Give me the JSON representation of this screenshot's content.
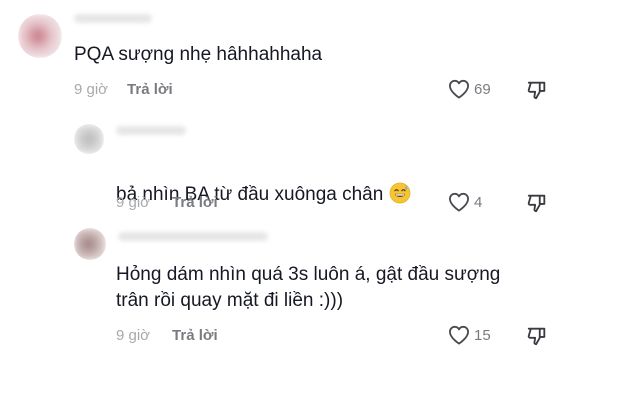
{
  "comments": [
    {
      "text": "PQA sượng nhẹ hâhhahhaha",
      "time": "9 giờ",
      "reply_label": "Trả lời",
      "likes": "69"
    },
    {
      "text": "bả nhìn BA từ đầu xuônga chân",
      "emoji": "grinning-sweat-emoji",
      "time": "9 giờ",
      "reply_label": "Trả lời",
      "likes": "4"
    },
    {
      "text": "Hỏng dám nhìn quá 3s luôn á, gật đầu sượng\ntrân rồi quay mặt đi liền :)))",
      "time": "9 giờ",
      "reply_label": "Trả lời",
      "likes": "15"
    }
  ],
  "icons": {
    "like": "heart-outline-icon",
    "dislike": "thumbs-down-icon"
  },
  "colors": {
    "text": "#161823",
    "meta": "#a8a9ad",
    "reply": "#7a7b80"
  }
}
